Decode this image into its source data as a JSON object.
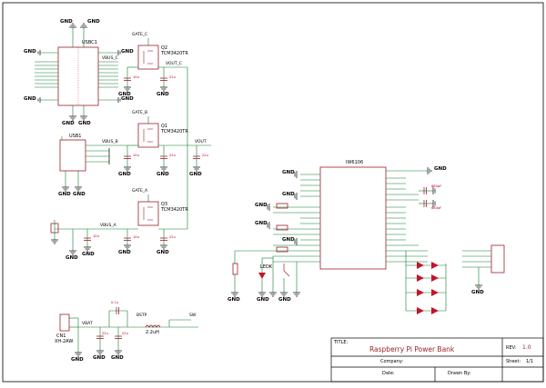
{
  "colors": {
    "wire": "#0a7d2c",
    "part": "#9c1f2a",
    "frame": "#000000",
    "pin_text": "#b0002a"
  },
  "title_block": {
    "title_label": "TITLE:",
    "title_value": "Raspberry Pi Power Bank",
    "rev_label": "REV:",
    "rev_value": "1.0",
    "company_label": "Company:",
    "sheet_label": "Sheet:",
    "sheet_value": "1/1",
    "date_label": "Date:",
    "drawn_label": "Drawn By:"
  },
  "refs": {
    "usbc1": "USBC1",
    "usb1": "USB1",
    "q1": "Q1",
    "q2": "Q2",
    "q3": "Q3",
    "q_part": "TCM3420TR",
    "u1": "IW6106",
    "cn1": "CN1",
    "cn1_part": "XH-2AW",
    "l1": "2.2uH",
    "ledk": "LEDK"
  },
  "nets": {
    "gate_c": "GATE_C",
    "gate_b": "GATE_B",
    "gate_a": "GATE_A",
    "vout_c": "VOUT_C",
    "vout": "VOUT",
    "vbus_c": "VBUS_C",
    "vbus_b": "VBUS_B",
    "vbus_a": "VBUS_A",
    "vbat": "VBAT",
    "bstp": "BSTP",
    "sw": "SW"
  },
  "gnd_label": "GND",
  "passives": {
    "c_22u": "22u",
    "c_10u": "10u",
    "c_680p": "680pF",
    "c_01u": "0.1u"
  }
}
